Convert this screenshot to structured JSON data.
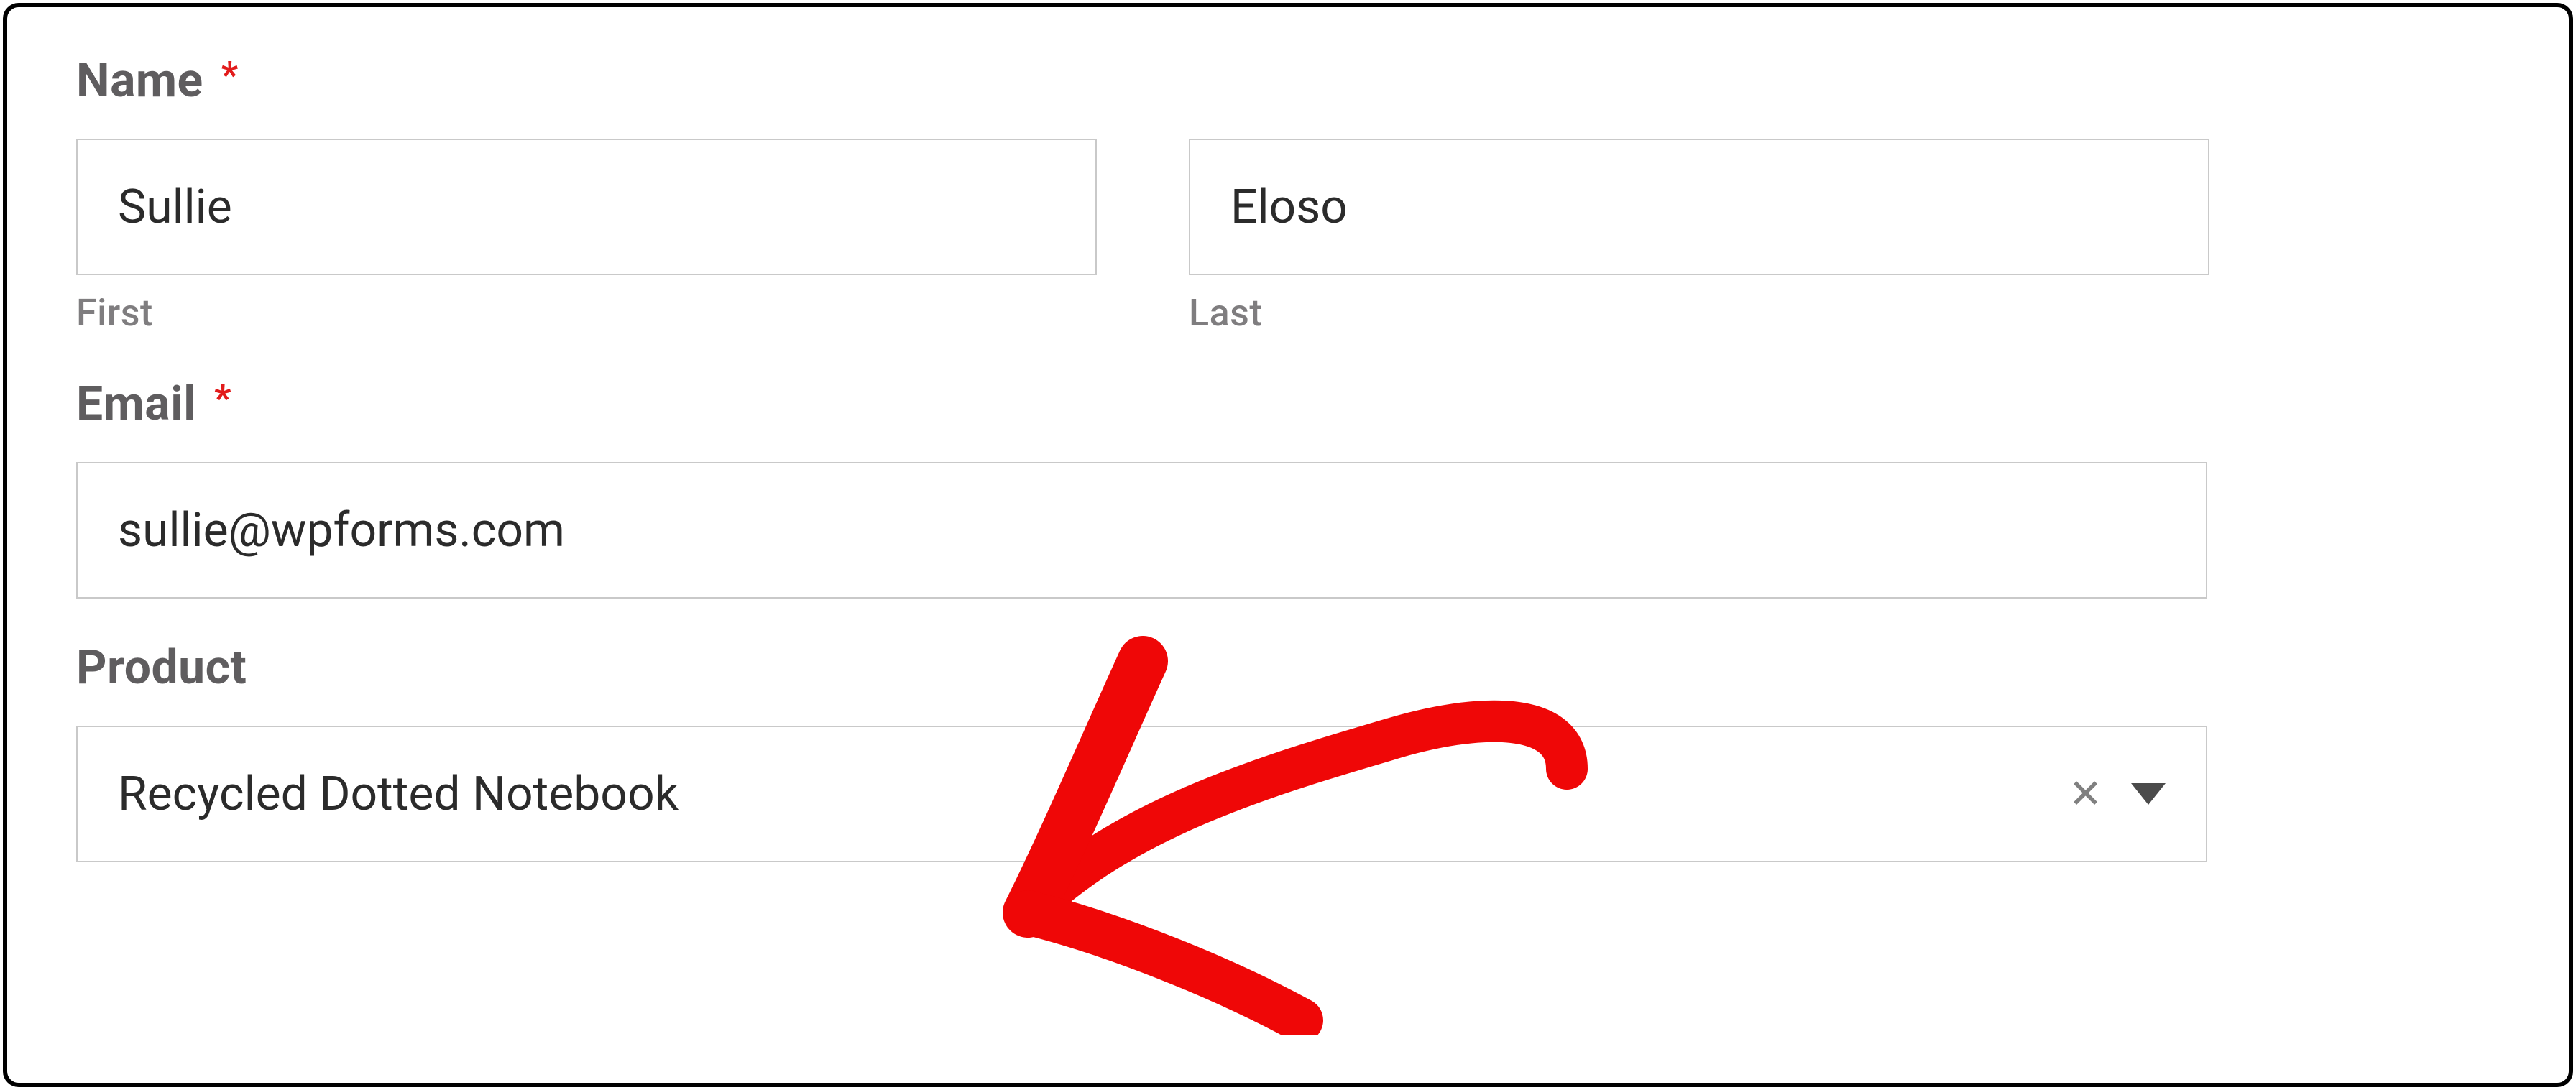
{
  "form": {
    "name": {
      "label": "Name",
      "required_marker": "*",
      "first": {
        "value": "Sullie",
        "sublabel": "First"
      },
      "last": {
        "value": "Eloso",
        "sublabel": "Last"
      }
    },
    "email": {
      "label": "Email",
      "required_marker": "*",
      "value": "sullie@wpforms.com"
    },
    "product": {
      "label": "Product",
      "selected": "Recycled Dotted Notebook"
    }
  },
  "colors": {
    "label": "#5f5d5f",
    "required": "#e21b1b",
    "input_border": "#c9c9c9",
    "text": "#2b2b2b",
    "sublabel": "#7f7d7f",
    "annotation": "#ef0707"
  }
}
